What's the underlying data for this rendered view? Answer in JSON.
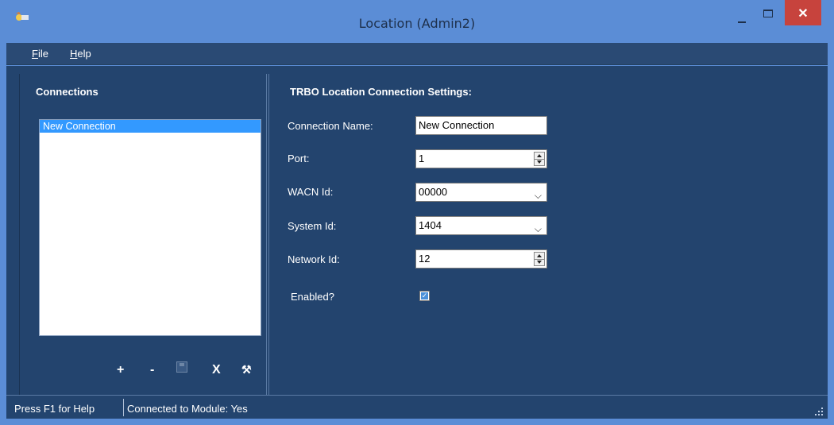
{
  "window": {
    "title": "Location (Admin2)",
    "close_glyph": "✕"
  },
  "menu": {
    "file_mnemonic": "F",
    "file_rest": "ile",
    "help_mnemonic": "H",
    "help_rest": "elp"
  },
  "connections": {
    "title": "Connections",
    "items": [
      {
        "label": "New Connection",
        "selected": true
      }
    ],
    "toolbar": {
      "add": "+",
      "remove": "-",
      "delete": "X",
      "tools": "⚒"
    }
  },
  "settings": {
    "title": "TRBO Location Connection Settings:",
    "connection_name_label": "Connection Name:",
    "connection_name_value": "New Connection",
    "port_label": "Port:",
    "port_value": "1",
    "wacn_label": "WACN Id:",
    "wacn_value": "00000",
    "system_label": "System Id:",
    "system_value": "1404",
    "network_label": "Network Id:",
    "network_value": "12",
    "enabled_label": "Enabled?",
    "enabled_checked": true,
    "check_glyph": "✓",
    "dropdown_glyph": "⌵"
  },
  "status": {
    "help": "Press F1 for Help",
    "connection": "Connected to Module: Yes"
  },
  "colors": {
    "titlebar": "#5b8dd6",
    "panel": "#23446e",
    "close_button": "#c7433d",
    "selection": "#3399ff"
  }
}
